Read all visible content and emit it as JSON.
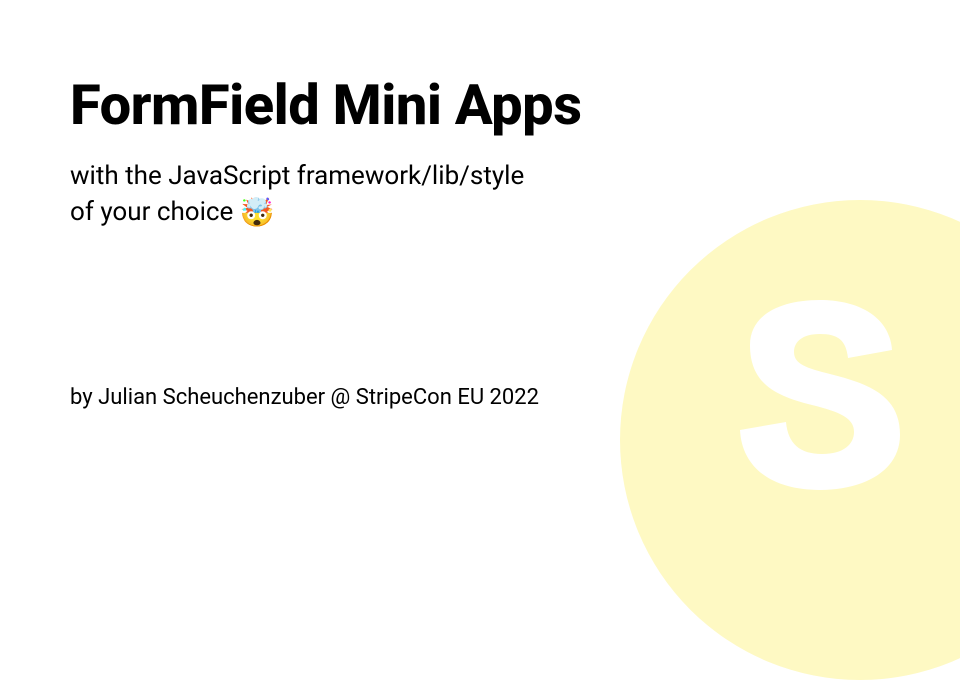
{
  "slide": {
    "title": "FormField Mini Apps",
    "subtitle_line1": "with the JavaScript framework/lib/style",
    "subtitle_line2": "of your choice",
    "emoji": "🤯",
    "byline": "by Julian Scheuchenzuber @ StripeCon EU 2022"
  }
}
